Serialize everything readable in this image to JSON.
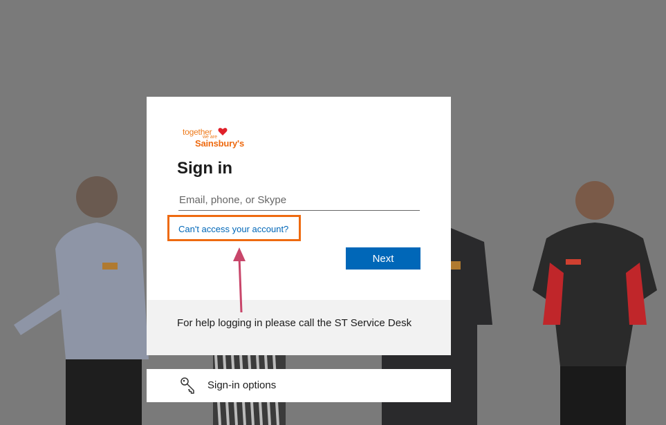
{
  "logo": {
    "line1": "together",
    "line2": "we are",
    "line3": "Sainsbury's",
    "brand_color": "#ee6a10"
  },
  "signin": {
    "title": "Sign in",
    "email_placeholder": "Email, phone, or Skype",
    "email_value": "",
    "cant_access_link": "Can't access your account?",
    "next_button": "Next"
  },
  "help": {
    "text": "For help logging in please call the ST Service Desk"
  },
  "options": {
    "label": "Sign-in options",
    "icon": "key-icon"
  },
  "annotation": {
    "highlight_color": "#ee6a10",
    "arrow_color": "#c8466a"
  },
  "colors": {
    "accent": "#0067b8",
    "background": "#7a7a7a"
  }
}
